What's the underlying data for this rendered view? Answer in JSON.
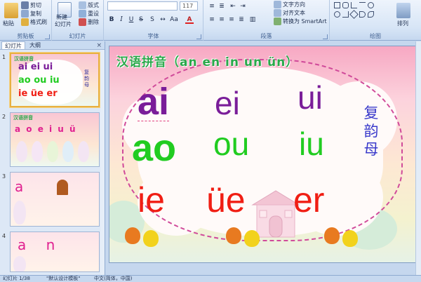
{
  "ribbon": {
    "clipboard": {
      "label": "剪贴板",
      "paste": "粘贴",
      "cut": "剪切",
      "copy": "复制",
      "format_painter": "格式刷"
    },
    "slides": {
      "label": "幻灯片",
      "new_slide": "新建",
      "new_slide_2": "幻灯片",
      "layout": "版式",
      "reset": "重设",
      "delete": "删除"
    },
    "font": {
      "label": "字体",
      "size": "117"
    },
    "paragraph": {
      "label": "段落",
      "text_direction": "文字方向",
      "align_text": "对齐文本",
      "smartart": "转换为 SmartArt"
    },
    "drawing": {
      "label": "绘图",
      "arrange": "排列"
    }
  },
  "left_pane": {
    "tabs": [
      "幻灯片",
      "大纲"
    ],
    "close": "×",
    "slides": [
      {
        "number": "1",
        "rows": [
          "ai ei ui",
          "ao ou iu",
          "ie üe er"
        ],
        "side": "复韵母",
        "title": "汉语拼音"
      },
      {
        "number": "2",
        "rows": [
          "a o e i u ü"
        ],
        "title": "汉语拼音"
      },
      {
        "number": "3",
        "rows": [
          "a"
        ]
      },
      {
        "number": "4",
        "rows": [
          "a n"
        ]
      }
    ]
  },
  "slide": {
    "title": "汉语拼音（an en in un ün）",
    "row1": [
      "ai",
      "ei",
      "ui"
    ],
    "row2": [
      "ao",
      "ou",
      "iu"
    ],
    "row3": [
      "ie",
      "üe",
      "er"
    ],
    "side_label": "复韵母"
  },
  "status": {
    "slide_count": "幻灯片 1/38",
    "theme": "\"默认设计模板\"",
    "language": "中文(简体，中国)"
  },
  "colors": {
    "purple": "#7a1d99",
    "green": "#21cc21",
    "red": "#f01e14",
    "selection": "#e8b040"
  }
}
